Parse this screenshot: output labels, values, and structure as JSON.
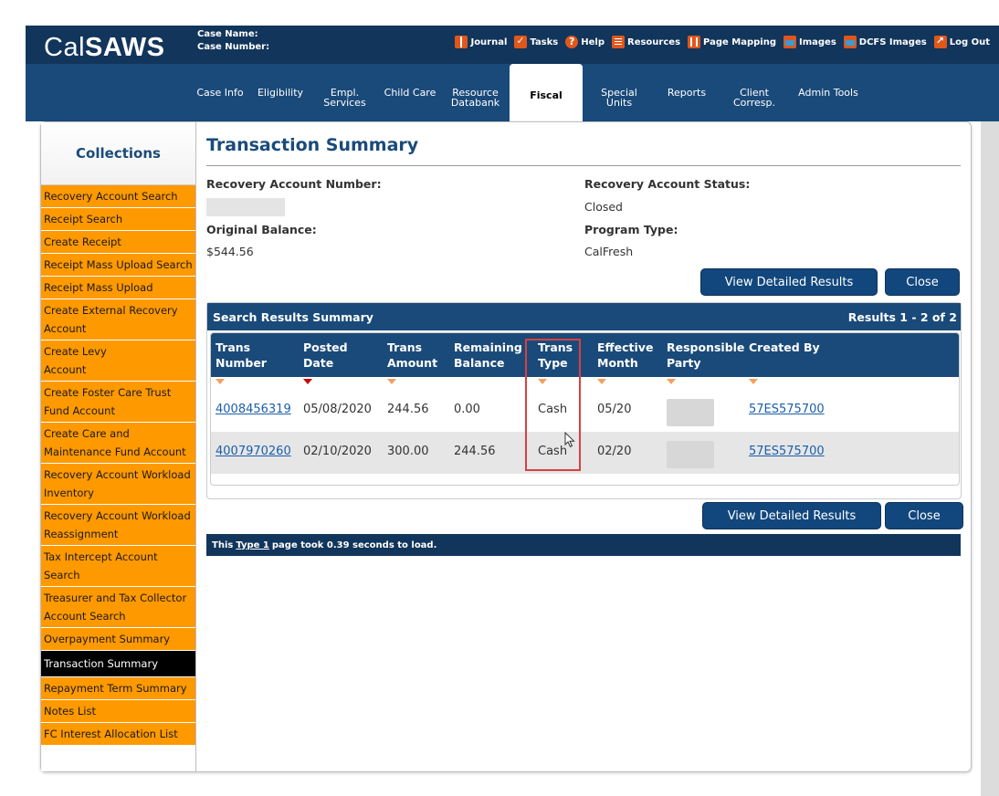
{
  "header": {
    "logo_text_regular": "Cal",
    "logo_text_bold": "SAWS",
    "case_name_label": "Case Name:",
    "case_number_label": "Case Number:",
    "util_links": [
      {
        "label": "Journal",
        "icon": "journal-icon"
      },
      {
        "label": "Tasks",
        "icon": "tasks-icon"
      },
      {
        "label": "Help",
        "icon": "help-icon"
      },
      {
        "label": "Resources",
        "icon": "resources-icon"
      },
      {
        "label": "Page Mapping",
        "icon": "page-mapping-icon"
      },
      {
        "label": "Images",
        "icon": "images-icon"
      },
      {
        "label": "DCFS Images",
        "icon": "images-icon"
      },
      {
        "label": "Log Out",
        "icon": "logout-icon"
      }
    ]
  },
  "nav": {
    "tabs": [
      {
        "line1": "Case Info",
        "line2": ""
      },
      {
        "line1": "Eligibility",
        "line2": ""
      },
      {
        "line1": "Empl.",
        "line2": "Services"
      },
      {
        "line1": "Child Care",
        "line2": ""
      },
      {
        "line1": "Resource",
        "line2": "Databank"
      },
      {
        "line1": "Fiscal",
        "line2": ""
      },
      {
        "line1": "Special",
        "line2": "Units"
      },
      {
        "line1": "Reports",
        "line2": ""
      },
      {
        "line1": "Client",
        "line2": "Corresp."
      },
      {
        "line1": "Admin Tools",
        "line2": ""
      }
    ],
    "active_tab": "Fiscal"
  },
  "sidebar": {
    "title": "Collections",
    "items": [
      "Recovery Account Search",
      "Receipt Search",
      "Create Receipt",
      "Receipt Mass Upload Search",
      "Receipt Mass Upload",
      "Create External Recovery Account",
      "Create Levy Account",
      "Create Foster Care Trust Fund Account",
      "Create Care and Maintenance Fund Account",
      "Recovery Account Workload Inventory",
      "Recovery Account Workload Reassignment",
      "Tax Intercept Account Search",
      "Treasurer and Tax Collector Account Search",
      "Overpayment Summary",
      "Transaction Summary",
      "Repayment Term Summary",
      "Notes List",
      "FC Interest Allocation List"
    ],
    "active_item": "Transaction Summary"
  },
  "main": {
    "title": "Transaction Summary",
    "recovery_account_number_label": "Recovery Account Number:",
    "recovery_account_status_label": "Recovery Account Status:",
    "recovery_account_status_value": "Closed",
    "original_balance_label": "Original Balance:",
    "original_balance_value": "$544.56",
    "program_type_label": "Program Type:",
    "program_type_value": "CalFresh",
    "view_detailed_results_label": "View Detailed Results",
    "close_label": "Close"
  },
  "results": {
    "header_title": "Search Results Summary",
    "count_text": "Results 1 - 2 of 2",
    "columns": [
      {
        "line1": "Trans",
        "line2": "Number"
      },
      {
        "line1": "Posted",
        "line2": "Date"
      },
      {
        "line1": "Trans",
        "line2": "Amount"
      },
      {
        "line1": "Remaining",
        "line2": "Balance"
      },
      {
        "line1": "Trans",
        "line2": "Type"
      },
      {
        "line1": "Effective",
        "line2": "Month"
      },
      {
        "line1": "Responsible",
        "line2": "Party"
      },
      {
        "line1": "Created By",
        "line2": ""
      }
    ],
    "rows": [
      {
        "trans_number": "4008456319",
        "posted_date": "05/08/2020",
        "trans_amount": "244.56",
        "remaining_balance": "0.00",
        "trans_type": "Cash",
        "effective_month": "05/20",
        "created_by": "57ES575700"
      },
      {
        "trans_number": "4007970260",
        "posted_date": "02/10/2020",
        "trans_amount": "300.00",
        "remaining_balance": "244.56",
        "trans_type": "Cash",
        "effective_month": "02/20",
        "created_by": "57ES575700"
      }
    ]
  },
  "footer": {
    "prefix": "This",
    "link": "Type 1",
    "suffix": "page took 0.39 seconds to load."
  },
  "colors": {
    "header_navy": "#12355b",
    "nav_blue": "#1a4a7a",
    "sidebar_orange": "#ff9900",
    "highlight_red": "#d94040",
    "link_blue": "#1a5faa"
  }
}
